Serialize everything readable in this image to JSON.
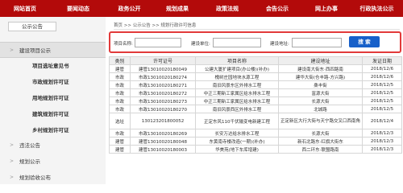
{
  "topnav": {
    "items": [
      "网站首页",
      "要闻动态",
      "政务公开",
      "规划成果",
      "政策法规",
      "会告公示",
      "网上办事",
      "行政执法公示"
    ]
  },
  "sidebar": {
    "title": "公示公告",
    "items": [
      {
        "label": "建设项目公示",
        "arrow": ">"
      },
      {
        "label": "项目选址意见书"
      },
      {
        "label": "市政规划许可证"
      },
      {
        "label": "用地规划许可证"
      },
      {
        "label": "建筑规划许可证"
      },
      {
        "label": "乡村规划许可证"
      },
      {
        "label": "违法公告",
        "arrow": ">"
      },
      {
        "label": "规划公示",
        "arrow": ">"
      },
      {
        "label": "规划验收公布",
        "arrow": ">"
      }
    ]
  },
  "breadcrumb": "首页 >> 公示公告 >> 规划行政许可信息",
  "search": {
    "project_label": "项目名称:",
    "unit_label": "建设单位:",
    "address_label": "建设地址:",
    "button_label": "搜 索"
  },
  "table": {
    "headers": [
      "类别",
      "许可证号",
      "项目名称",
      "建设地址",
      "发证日期"
    ],
    "rows": [
      [
        "建管",
        "建管13010020180049",
        "公建大厦扩建项目(办公楼)(补办)",
        "建设南大街东·西四路南",
        "2018/12/6"
      ],
      [
        "市政",
        "市政13010020180274",
        "槐树庄园地块水源工程",
        "建华大街(仓丰路-方兴路)",
        "2018/12/6"
      ],
      [
        "市政",
        "市政13010020180271",
        "南旧风景东区外排水工程",
        "桑丰街",
        "2018/12/5"
      ],
      [
        "市政",
        "市政13010020180272",
        "中正三期新工家属区给水排水工程",
        "富源大街",
        "2018/12/5"
      ],
      [
        "市政",
        "市政13010020180273",
        "中正三期新工家属区给水排水工程",
        "长源大街",
        "2018/12/5"
      ],
      [
        "市政",
        "市政13010020180270",
        "南旧风景西区外排水工程",
        "北城路",
        "2018/12/5"
      ],
      [
        "选址",
        "130123201800052",
        "正定东风110千伏输变电新建工程",
        "正定新区大行大街与天宁路交叉口西南角",
        "2018/12/4"
      ],
      [
        "市政",
        "市政13010020180269",
        "长安万达给水排水工程",
        "长源大街",
        "2018/12/3"
      ],
      [
        "建管",
        "建管13010020180048",
        "东黄南寺楼改造(一期)(补办)",
        "新石北路东·红旗大街东",
        "2018/12/3"
      ],
      [
        "建管",
        "建管13010020180003",
        "华美苑(地下车库增建)",
        "西二环东·联盟路南",
        "2018/12/3"
      ]
    ]
  }
}
